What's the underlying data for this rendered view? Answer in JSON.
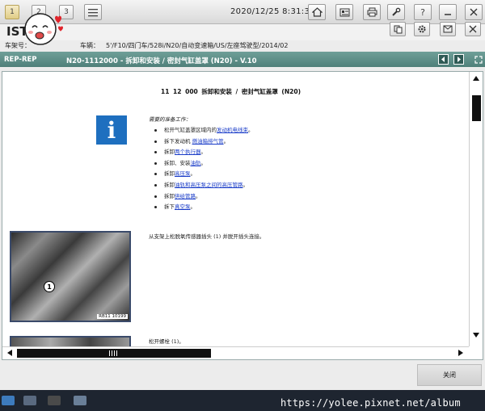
{
  "toolbar": {
    "tab1": "1",
    "tab2": "2",
    "tab3": "3",
    "datetime": "2020/12/25 8:31:39",
    "help": "?"
  },
  "app": {
    "title": "IST"
  },
  "vehicle": {
    "vin_label": "车架号：",
    "vehicle_label": "车辆：",
    "vehicle_value": "5'/F10/四门车/528i/N20/自动变速箱/US/左座驾驶型/2014/02"
  },
  "titlebar": {
    "prefix": "REP-REP",
    "title": "N20-1112000 - 拆卸和安装 / 密封气缸盖罩 (N20) - V.10"
  },
  "document": {
    "title": "11 12 000    拆卸和安装 / 密封气缸盖罩 (N20)",
    "info_icon": "i",
    "prep_title": "需要的准备工作：",
    "prep_items": [
      {
        "pre": "松开气缸盖罩区域内的",
        "link": "发动机电线束",
        "post": "。"
      },
      {
        "pre": "拆下发动机 ",
        "link": "燃油箱排气管",
        "post": "。"
      },
      {
        "pre": "拆卸",
        "link": "两个执行器",
        "post": "。"
      },
      {
        "pre": "拆卸、安装",
        "link": "油轨",
        "post": "。"
      },
      {
        "pre": "拆卸",
        "link": "高压泵",
        "post": "。"
      },
      {
        "pre": "拆卸",
        "link": "油轨和高压泵之间的高压管路",
        "post": "。"
      },
      {
        "pre": "拆卸",
        "link": "供给管路",
        "post": "。"
      },
      {
        "pre": "拆下",
        "link": "真空泵",
        "post": "。"
      }
    ],
    "step1_text": "从支架上松脱氧传感器插头 (1) 并脱开插头连接。",
    "photo_marker": "1",
    "photo_code": "RB11 10199",
    "step2_text": "松开螺栓 (1)。"
  },
  "buttons": {
    "close": "关闭"
  },
  "watermark": "https://yolee.pixnet.net/album",
  "colors": {
    "titlebar": "#5b8c86",
    "info_icon": "#1e6fbf",
    "link": "#1a3cc8"
  }
}
